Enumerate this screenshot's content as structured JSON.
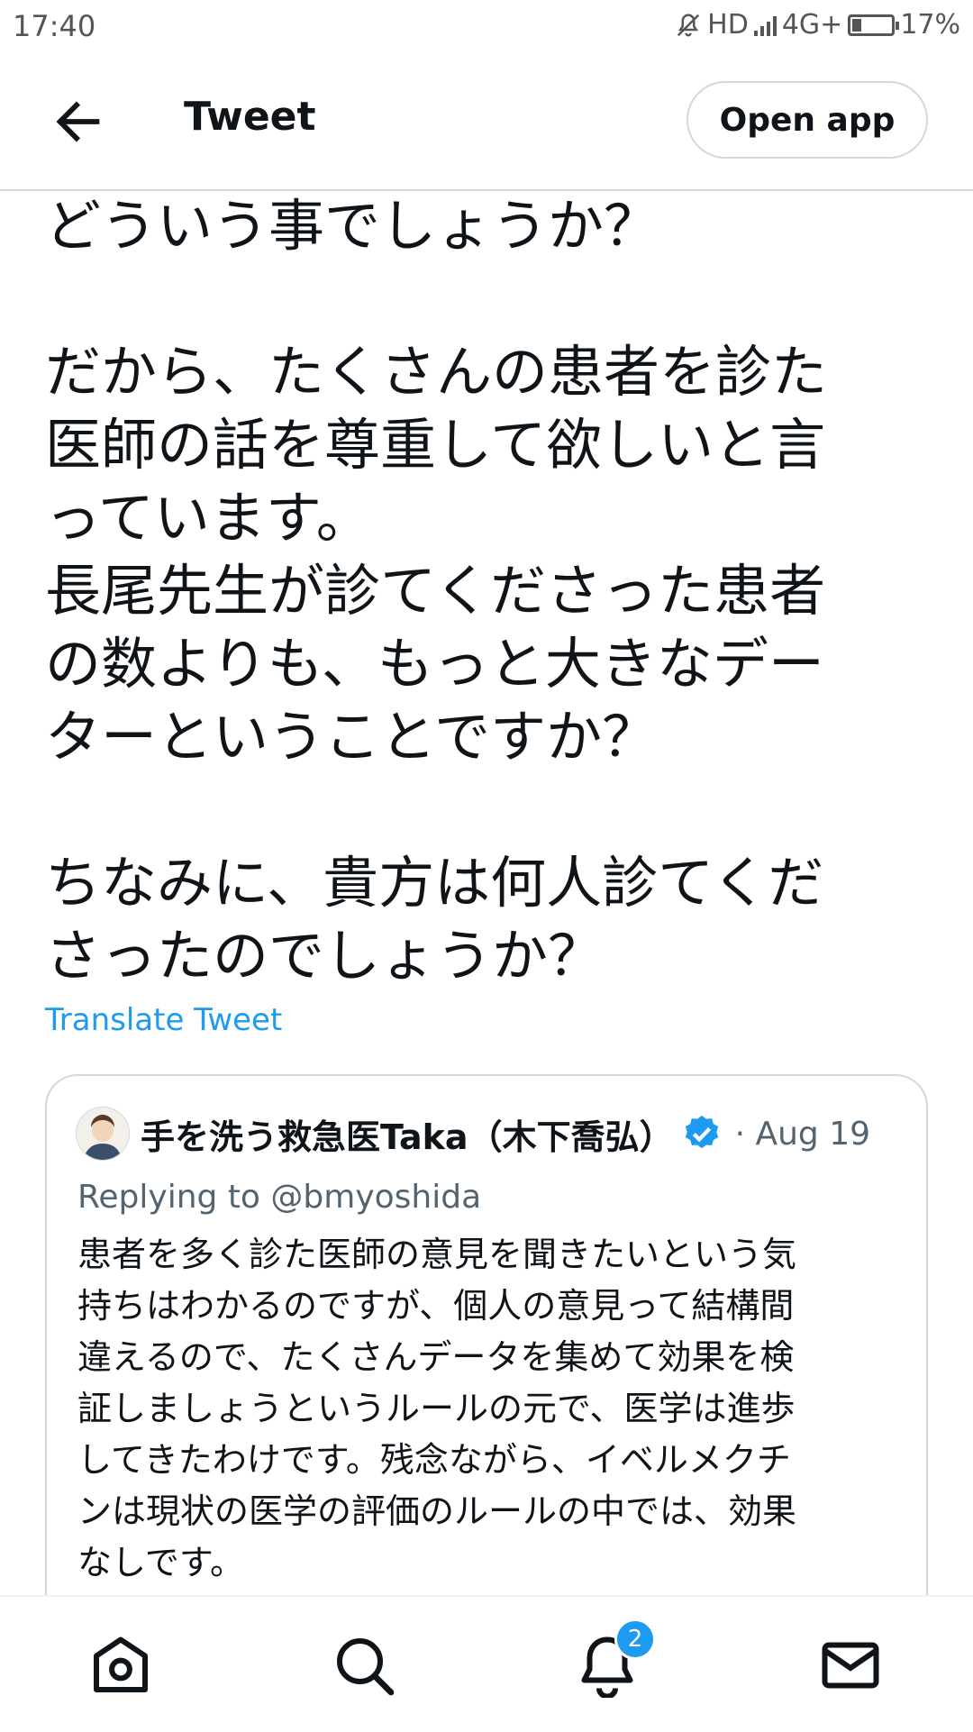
{
  "status_bar": {
    "time": "17:40",
    "network": "HD",
    "network2": "4G+",
    "battery": "17%"
  },
  "header": {
    "title": "Tweet",
    "open_app": "Open app"
  },
  "tweet": {
    "text": "どういう事でしょうか？\n\nだから、たくさんの患者を診た\n医師の話を尊重して欲しいと言\nっています。\n長尾先生が診てくださった患者\nの数よりも、もっと大きなデー\nターということですか？\n\nちなみに、貴方は何人診てくだ\nさったのでしょうか？",
    "translate": "Translate Tweet"
  },
  "quoted_tweet": {
    "name": "手を洗う救急医Taka（木下喬弘）",
    "date": "· Aug 19",
    "replying": "Replying to @bmyoshida",
    "text": "患者を多く診た医師の意見を聞きたいという気\n持ちはわかるのですが、個人の意見って結構間\n違えるので、たくさんデータを集めて効果を検\n証しましょうというルールの元で、医学は進歩\nしてきたわけです。残念ながら、イベルメクチ\nンは現状の医学の評価のルールの中では、効果\nなしです。"
  },
  "bottom_nav": {
    "items": [
      "home-icon",
      "search-icon",
      "bell-icon",
      "mail-icon"
    ],
    "notification_count": "2"
  },
  "colors": {
    "accent": "#1d9bf0",
    "text": "#0f1419",
    "secondary": "#536471",
    "border": "#cfd9de"
  }
}
